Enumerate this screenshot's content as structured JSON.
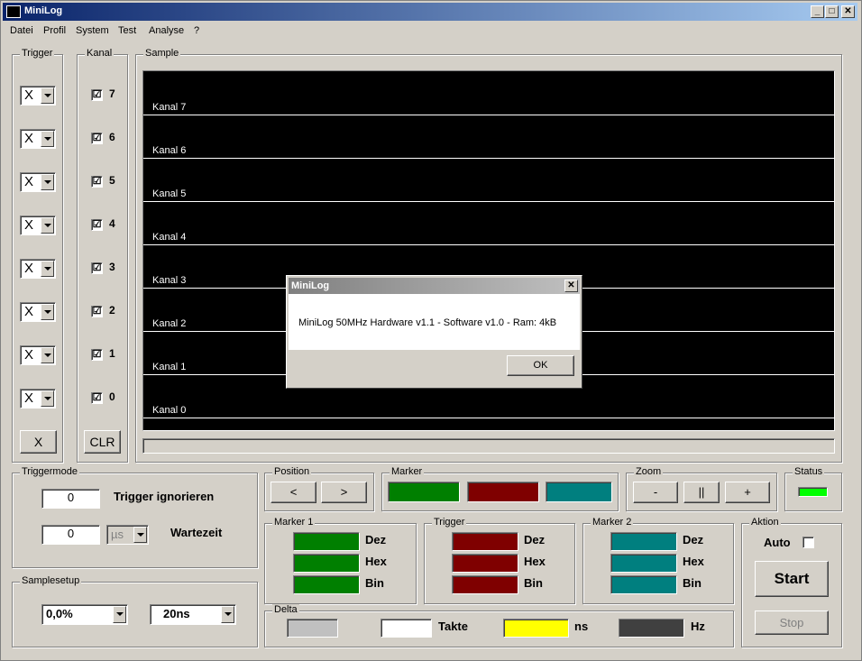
{
  "window": {
    "title": "MiniLog",
    "buttons": {
      "minimize": "_",
      "maximize": "□",
      "close": "✕"
    }
  },
  "menu": [
    "Datei",
    "Profil",
    "System",
    "Test",
    "Analyse",
    "?"
  ],
  "trigger": {
    "label": "Trigger",
    "values": [
      "X",
      "X",
      "X",
      "X",
      "X",
      "X",
      "X",
      "X"
    ],
    "clear_button": "X"
  },
  "kanal": {
    "label": "Kanal",
    "channels": [
      "7",
      "6",
      "5",
      "4",
      "3",
      "2",
      "1",
      "0"
    ],
    "checked": "☑",
    "clr_button": "CLR"
  },
  "sample": {
    "label": "Sample",
    "lanes": [
      "Kanal 7",
      "Kanal 6",
      "Kanal 5",
      "Kanal 4",
      "Kanal 3",
      "Kanal 2",
      "Kanal 1",
      "Kanal 0"
    ]
  },
  "triggermode": {
    "label": "Triggermode",
    "ignore_value": "0",
    "ignore_label": "Trigger ignorieren",
    "wait_value": "0",
    "wait_unit": "µs",
    "wait_label": "Wartezeit"
  },
  "samplesetup": {
    "label": "Samplesetup",
    "pretrigger": "0,0%",
    "rate": "20ns"
  },
  "position": {
    "label": "Position",
    "left": "<",
    "right": ">"
  },
  "marker": {
    "label": "Marker",
    "colors": [
      "#007f00",
      "#7f0000",
      "#007f7f"
    ]
  },
  "zoom": {
    "label": "Zoom",
    "minus": "-",
    "reset": "||",
    "plus": "+"
  },
  "status": {
    "label": "Status",
    "led_color": "#00ff00"
  },
  "marker1": {
    "label": "Marker 1",
    "rows": [
      "Dez",
      "Hex",
      "Bin"
    ],
    "color": "#007f00"
  },
  "triggerinfo": {
    "label": "Trigger",
    "rows": [
      "Dez",
      "Hex",
      "Bin"
    ],
    "color": "#7f0000"
  },
  "marker2": {
    "label": "Marker 2",
    "rows": [
      "Dez",
      "Hex",
      "Bin"
    ],
    "color": "#007f7f"
  },
  "delta": {
    "label": "Delta",
    "takte": "Takte",
    "ns": "ns",
    "hz": "Hz"
  },
  "aktion": {
    "label": "Aktion",
    "auto": "Auto",
    "start": "Start",
    "stop": "Stop"
  },
  "dialog": {
    "title": "MiniLog",
    "close": "✕",
    "message": "MiniLog 50MHz Hardware v1.1 - Software v1.0 - Ram:  4kB",
    "ok": "OK"
  }
}
